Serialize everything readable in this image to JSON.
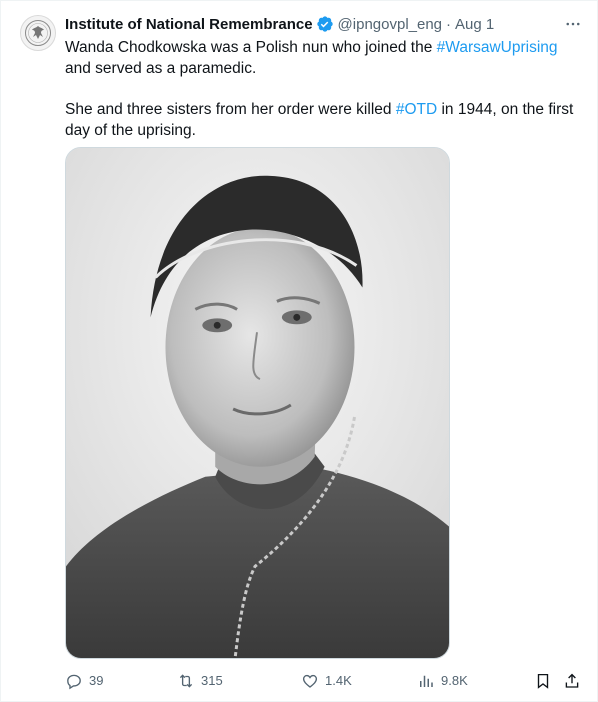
{
  "tweet": {
    "author_name": "Institute of National Remembrance",
    "handle": "@ipngovpl_eng",
    "separator": "·",
    "date": "Aug 1",
    "verified_icon": "verified-badge-icon",
    "more_icon": "more-icon",
    "text": {
      "p1_part1": "Wanda Chodkowska was a Polish nun who joined the ",
      "p1_hashtag": "#WarsawUprising",
      "p1_part2": "\nand served as a paramedic.",
      "p2_part1": "She and three sisters from her order were killed ",
      "p2_hashtag": "#OTD",
      "p2_part2": " in 1944, on the first\nday of the uprising."
    },
    "media": {
      "type": "photo"
    },
    "actions": {
      "replies": "39",
      "retweets": "315",
      "likes": "1.4K",
      "views": "9.8K"
    }
  },
  "colors": {
    "text": "#0f1419",
    "secondary": "#536471",
    "link": "#1d9bf0",
    "verified": "#1d9bf0",
    "border": "#cfd9de"
  }
}
